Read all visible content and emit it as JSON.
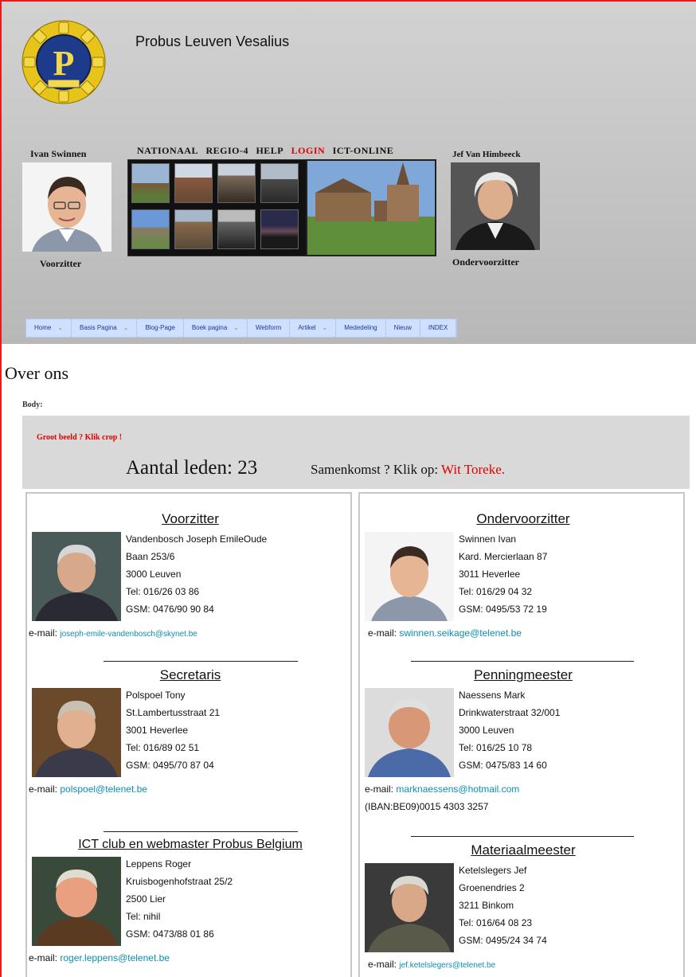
{
  "header": {
    "site_title": "Probus Leuven Vesalius",
    "left_person": {
      "name": "Ivan Swinnen",
      "role": "Voorzitter"
    },
    "right_person": {
      "name": "Jef Van Himbeeck",
      "role": "Ondervoorzitter"
    },
    "top_links": [
      "NATIONAAL",
      "REGIO-4",
      "HELP",
      "LOGIN",
      "ICT-ONLINE"
    ],
    "nav": [
      {
        "label": "Home",
        "arrow": "⌄"
      },
      {
        "label": "Basis Pagina",
        "arrow": "⌄"
      },
      {
        "label": "Blog-Page",
        "arrow": ""
      },
      {
        "label": "Boek pagina",
        "arrow": "⌄"
      },
      {
        "label": "Webform",
        "arrow": ""
      },
      {
        "label": "Artikel",
        "arrow": "⌄"
      },
      {
        "label": "Mededeling",
        "arrow": ""
      },
      {
        "label": "Nieuw",
        "arrow": ""
      },
      {
        "label": "INDEX",
        "arrow": ""
      }
    ]
  },
  "content": {
    "page_title": "Over ons",
    "body_label": "Body:",
    "groot_beeld": "Groot beeld ? Klik crop !",
    "aantal_leden": "Aantal leden: 23",
    "samenkomst_prefix": "Samenkomst ? Klik op:",
    "samenkomst_link": "Wit Toreke."
  },
  "left_cards": [
    {
      "title": "Voorzitter",
      "lines": [
        "Vandenbosch Joseph EmileOude",
        "Baan 253/6",
        "3000 Leuven",
        "Tel: 016/26 03 86",
        "GSM: 0476/90 90 84"
      ],
      "email_label": "e-mail:",
      "email": "joseph-emile-vandenbosch@skynet.be"
    },
    {
      "title": "Secretaris",
      "lines": [
        "Polspoel Tony",
        "St.Lambertusstraat 21",
        "3001 Heverlee",
        "Tel: 016/89 02 51",
        "GSM: 0495/70 87 04"
      ],
      "email_label": "e-mail:",
      "email": "polspoel@telenet.be"
    },
    {
      "title": "ICT club en webmaster Probus Belgium",
      "lines": [
        "Leppens Roger",
        "Kruisbogenhofstraat 25/2",
        "2500 Lier",
        "Tel: nihil",
        "GSM: 0473/88 01 86"
      ],
      "email_label": "e-mail:",
      "email": "roger.leppens@telenet.be"
    }
  ],
  "right_cards": [
    {
      "title": "Ondervoorzitter",
      "lines": [
        "Swinnen Ivan",
        "Kard. Mercierlaan 87",
        "3011 Heverlee",
        "Tel: 016/29 04 32",
        "GSM: 0495/53 72 19"
      ],
      "email_label": "e-mail:",
      "email": "swinnen.seikage@telenet.be"
    },
    {
      "title": "Penningmeester",
      "lines": [
        "Naessens Mark",
        "Drinkwaterstraat 32/001",
        "3000 Leuven",
        "Tel: 016/25 10 78",
        "GSM: 0475/83 14 60"
      ],
      "email_label": "e-mail:",
      "email": "marknaessens@hotmail.com",
      "extra": "(IBAN:BE09)0015 4303 3257"
    },
    {
      "title": "Materiaalmeester",
      "lines": [
        "Ketelslegers Jef",
        "Groenendries 2",
        "3211 Binkom",
        "Tel: 016/64 08 23",
        "GSM: 0495/24 34 74"
      ],
      "email_label": "e-mail:",
      "email": "jef.ketelslegers@telenet.be"
    }
  ]
}
